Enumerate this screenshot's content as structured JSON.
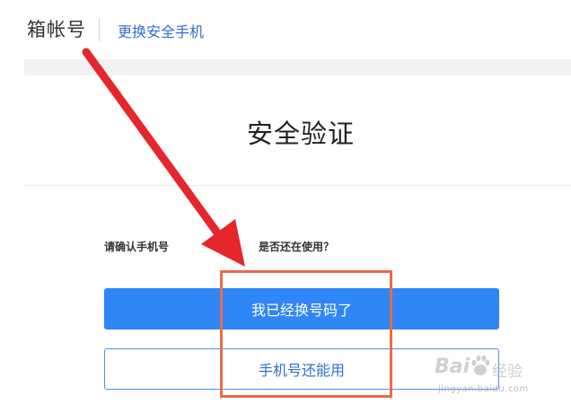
{
  "header": {
    "title": "箱帐号",
    "link_label": "更换安全手机"
  },
  "main": {
    "section_title": "安全验证",
    "prompt_left": "请确认手机号",
    "prompt_right": "是否还在使用？",
    "primary_button_label": "我已经换号码了",
    "secondary_button_label": "手机号还能用"
  },
  "annotations": {
    "arrow_color": "#e5262b",
    "highlight_color": "#ea6a48"
  },
  "watermark": {
    "brand_left": "Bai",
    "brand_right": "经验",
    "url": "jingyan.baidu.com"
  },
  "colors": {
    "accent": "#2f86f6",
    "link": "#2e6fd3"
  }
}
